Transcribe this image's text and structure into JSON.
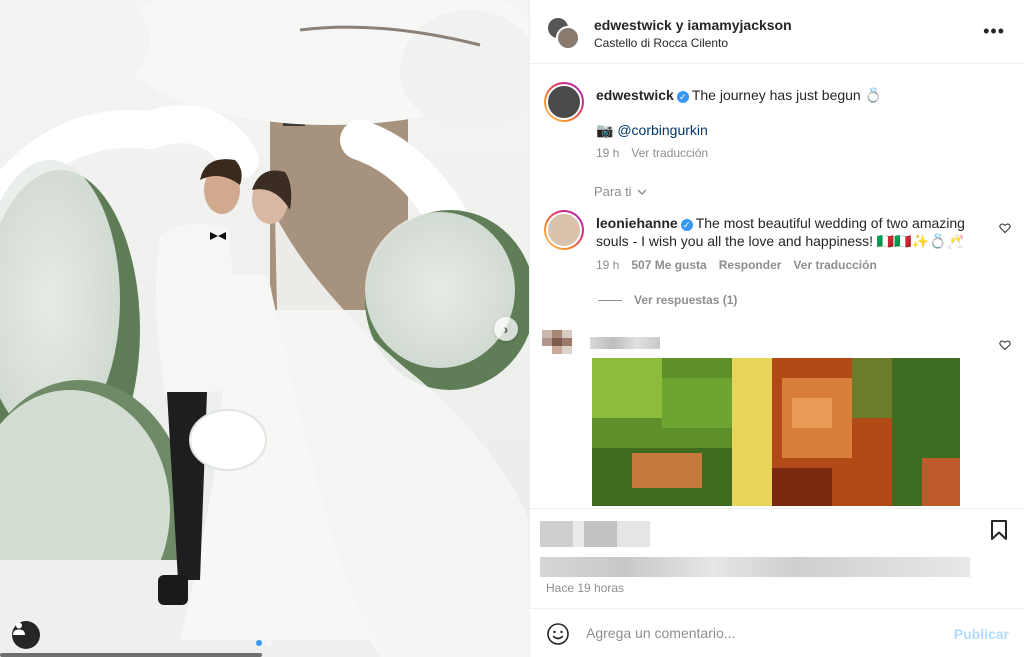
{
  "post": {
    "authors": "edwestwick y iamamyjackson",
    "location": "Castello di Rocca Cilento",
    "carousel_index": 1,
    "carousel_total": 2
  },
  "caption": {
    "username": "edwestwick",
    "text": "The journey has just begun 💍",
    "credit_icon": "📷",
    "credit": "@corbingurkin",
    "time": "19 h",
    "translate": "Ver traducción"
  },
  "filter": {
    "label": "Para ti",
    "icon": "chevron-down-icon"
  },
  "comment1": {
    "username": "leoniehanne",
    "text_line1": "The most beautiful wedding of two amazing",
    "text_line2": "souls - I wish you all the love and happiness! 🇮🇹🇮🇹✨💍🥂",
    "time": "19 h",
    "likes": "507 Me gusta",
    "reply": "Responder",
    "translate": "Ver traducción",
    "view_replies": "Ver respuestas (1)"
  },
  "footer": {
    "time_ago": "Hace 19 horas",
    "comment_placeholder": "Agrega un comentario...",
    "publish": "Publicar"
  },
  "colors": {
    "accent": "#3897f0",
    "muted_text": "#8e8e8e",
    "publish_disabled": "#b3dbff",
    "link": "#00376b"
  }
}
